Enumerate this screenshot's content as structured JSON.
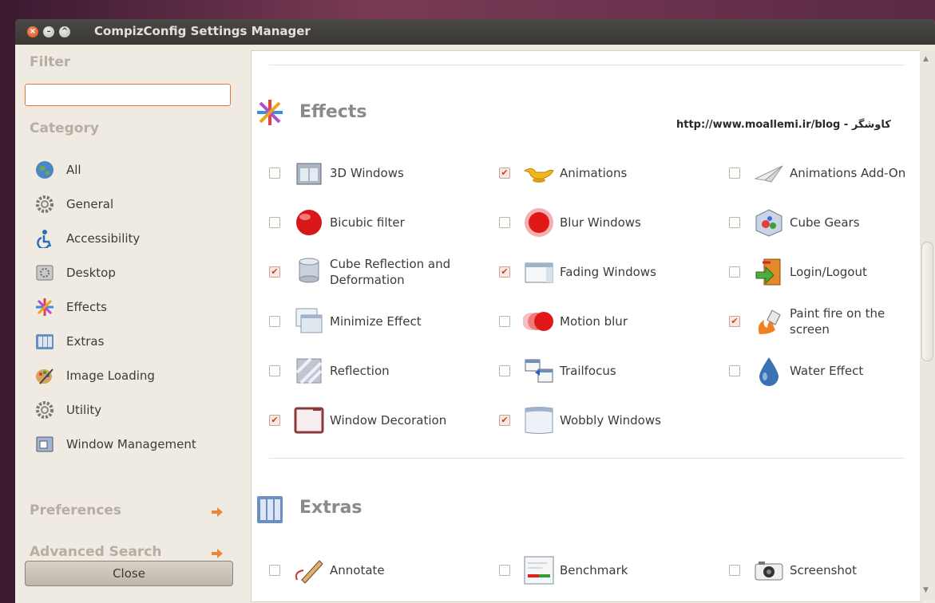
{
  "window": {
    "title": "CompizConfig Settings Manager"
  },
  "sidebar": {
    "filter_label": "Filter",
    "filter_value": "",
    "category_label": "Category",
    "categories": [
      {
        "label": "All",
        "icon": "globe-icon"
      },
      {
        "label": "General",
        "icon": "gear-icon"
      },
      {
        "label": "Accessibility",
        "icon": "accessibility-icon"
      },
      {
        "label": "Desktop",
        "icon": "desktop-icon"
      },
      {
        "label": "Effects",
        "icon": "effects-icon"
      },
      {
        "label": "Extras",
        "icon": "extras-icon"
      },
      {
        "label": "Image Loading",
        "icon": "image-loading-icon"
      },
      {
        "label": "Utility",
        "icon": "utility-icon"
      },
      {
        "label": "Window Management",
        "icon": "window-management-icon"
      }
    ],
    "preferences_label": "Preferences",
    "advanced_search_label": "Advanced Search",
    "close_label": "Close"
  },
  "main": {
    "watermark": "http://www.moallemi.ir/blog - کاوشگر",
    "effects": {
      "title": "Effects",
      "plugins": [
        {
          "name": "3D Windows",
          "checked": false
        },
        {
          "name": "Animations",
          "checked": true
        },
        {
          "name": "Animations Add-On",
          "checked": false
        },
        {
          "name": "Bicubic filter",
          "checked": false
        },
        {
          "name": "Blur Windows",
          "checked": false
        },
        {
          "name": "Cube Gears",
          "checked": false
        },
        {
          "name": "Cube Reflection and Deformation",
          "checked": true
        },
        {
          "name": "Fading Windows",
          "checked": true
        },
        {
          "name": "Login/Logout",
          "checked": false
        },
        {
          "name": "Minimize Effect",
          "checked": false
        },
        {
          "name": "Motion blur",
          "checked": false
        },
        {
          "name": "Paint fire on the screen",
          "checked": true
        },
        {
          "name": "Reflection",
          "checked": false
        },
        {
          "name": "Trailfocus",
          "checked": false
        },
        {
          "name": "Water Effect",
          "checked": false
        },
        {
          "name": "Window Decoration",
          "checked": true
        },
        {
          "name": "Wobbly Windows",
          "checked": true
        }
      ]
    },
    "extras": {
      "title": "Extras",
      "plugins": [
        {
          "name": "Annotate",
          "checked": false
        },
        {
          "name": "Benchmark",
          "checked": false
        },
        {
          "name": "Screenshot",
          "checked": false
        }
      ]
    }
  },
  "colors": {
    "accent": "#e0773f",
    "check": "#d0402a"
  }
}
